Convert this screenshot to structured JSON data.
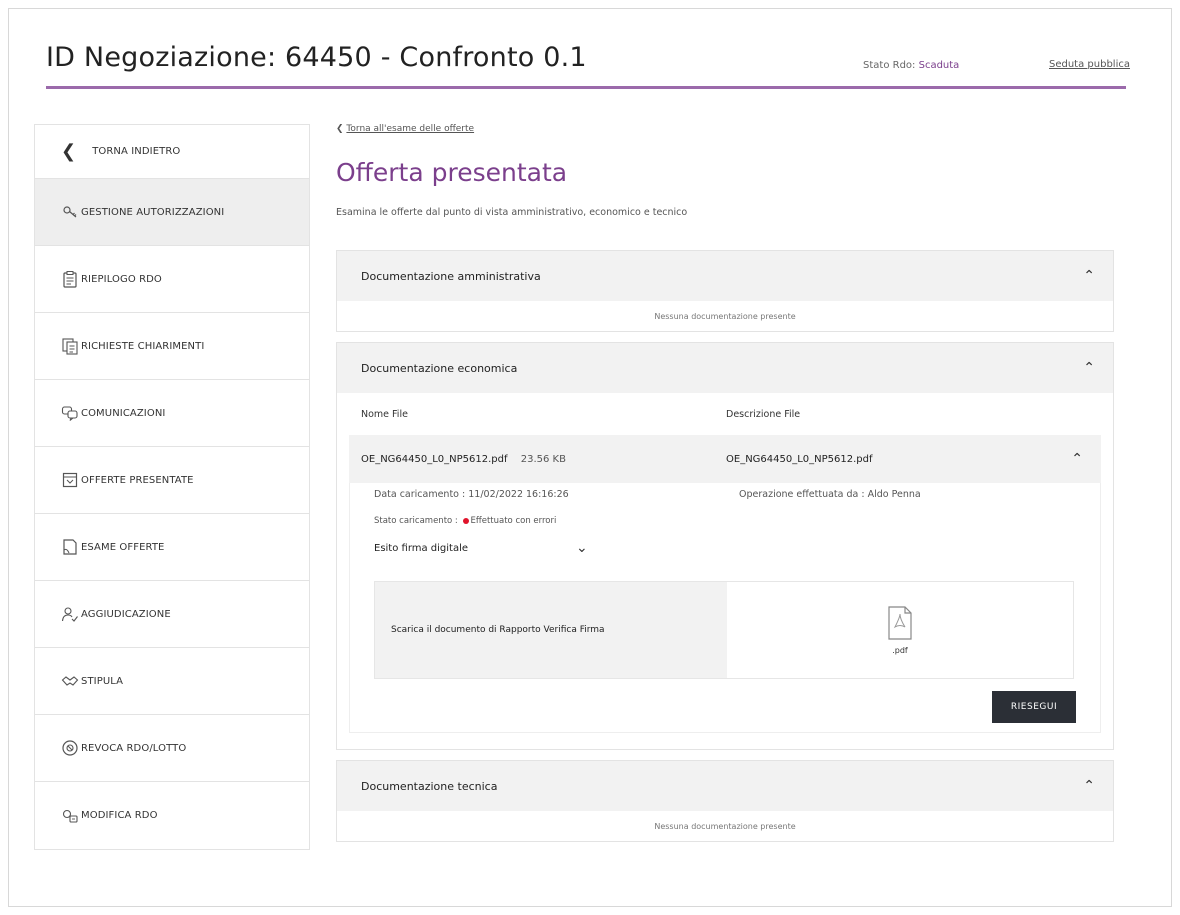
{
  "header": {
    "title": "ID Negoziazione: 64450 - Confronto 0.1",
    "status_label": "Stato Rdo:",
    "status_value": "Scaduta",
    "public_session_link": "Seduta pubblica"
  },
  "sidebar": {
    "back_label": "TORNA INDIETRO",
    "items": [
      {
        "label": "GESTIONE AUTORIZZAZIONI",
        "icon": "key-users-icon"
      },
      {
        "label": "RIEPILOGO RDO",
        "icon": "clipboard-icon"
      },
      {
        "label": "RICHIESTE CHIARIMENTI",
        "icon": "documents-question-icon"
      },
      {
        "label": "COMUNICAZIONI",
        "icon": "chat-bubbles-icon"
      },
      {
        "label": "OFFERTE PRESENTATE",
        "icon": "calendar-offer-icon"
      },
      {
        "label": "ESAME OFFERTE",
        "icon": "document-check-icon"
      },
      {
        "label": "AGGIUDICAZIONE",
        "icon": "user-award-icon"
      },
      {
        "label": "STIPULA",
        "icon": "handshake-icon"
      },
      {
        "label": "REVOCA RDO/LOTTO",
        "icon": "revoke-circle-icon"
      },
      {
        "label": "MODIFICA RDO",
        "icon": "edit-gear-icon"
      }
    ]
  },
  "main": {
    "breadcrumb": "Torna all'esame delle offerte",
    "page_title": "Offerta presentata",
    "description": "Esamina le offerte dal punto di vista amministrativo, economico e tecnico",
    "sections": {
      "admin": {
        "title": "Documentazione amministrativa",
        "empty_text": "Nessuna documentazione presente"
      },
      "economic": {
        "title": "Documentazione economica",
        "col_file_name": "Nome File",
        "col_file_desc": "Descrizione File",
        "file": {
          "name": "OE_NG64450_L0_NP5612.pdf",
          "size": "23.56 KB",
          "description": "OE_NG64450_L0_NP5612.pdf",
          "upload_date": "Data caricamento : 11/02/2022 16:16:26",
          "operator": "Operazione effettuata da : Aldo Penna",
          "upload_status_label": "Stato caricamento :",
          "upload_status_value": "Effettuato con errori",
          "signature_check_label": "Esito firma digitale",
          "download_report_label": "Scarica il documento di Rapporto Verifica Firma",
          "pdf_label": ".pdf",
          "rerun_button": "RIESEGUI"
        }
      },
      "technical": {
        "title": "Documentazione tecnica",
        "empty_text": "Nessuna documentazione presente"
      }
    }
  },
  "colors": {
    "accent": "#7b3f8c",
    "rule": "#9b6aab",
    "error_dot": "#e0132b",
    "button_bg": "#2b2f36"
  }
}
